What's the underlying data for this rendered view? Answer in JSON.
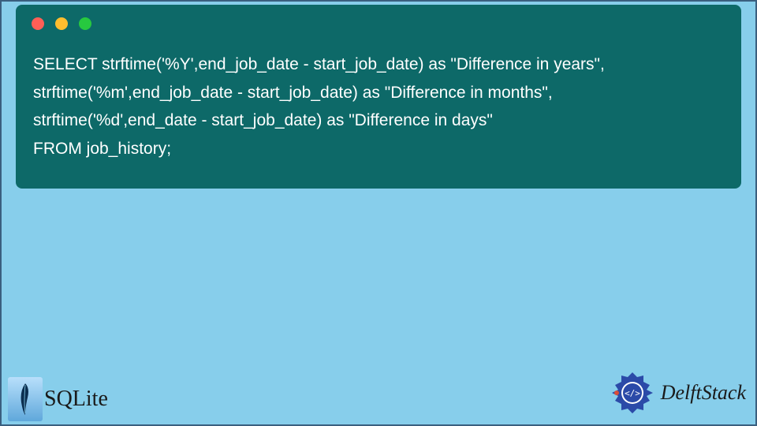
{
  "code": {
    "line1": "SELECT strftime('%Y',end_job_date - start_job_date) as \"Difference in years\",",
    "line2": "strftime('%m',end_job_date - start_job_date) as \"Difference in months\",",
    "line3": "strftime('%d',end_date - start_job_date) as \"Difference in days\"",
    "line4": "FROM job_history;"
  },
  "footer": {
    "left_brand": "SQLite",
    "right_brand": "DelftStack"
  },
  "colors": {
    "page_bg": "#87ceeb",
    "panel_bg": "#0d6968",
    "code_text": "#ffffff",
    "delft_logo": "#2b4aa8"
  }
}
